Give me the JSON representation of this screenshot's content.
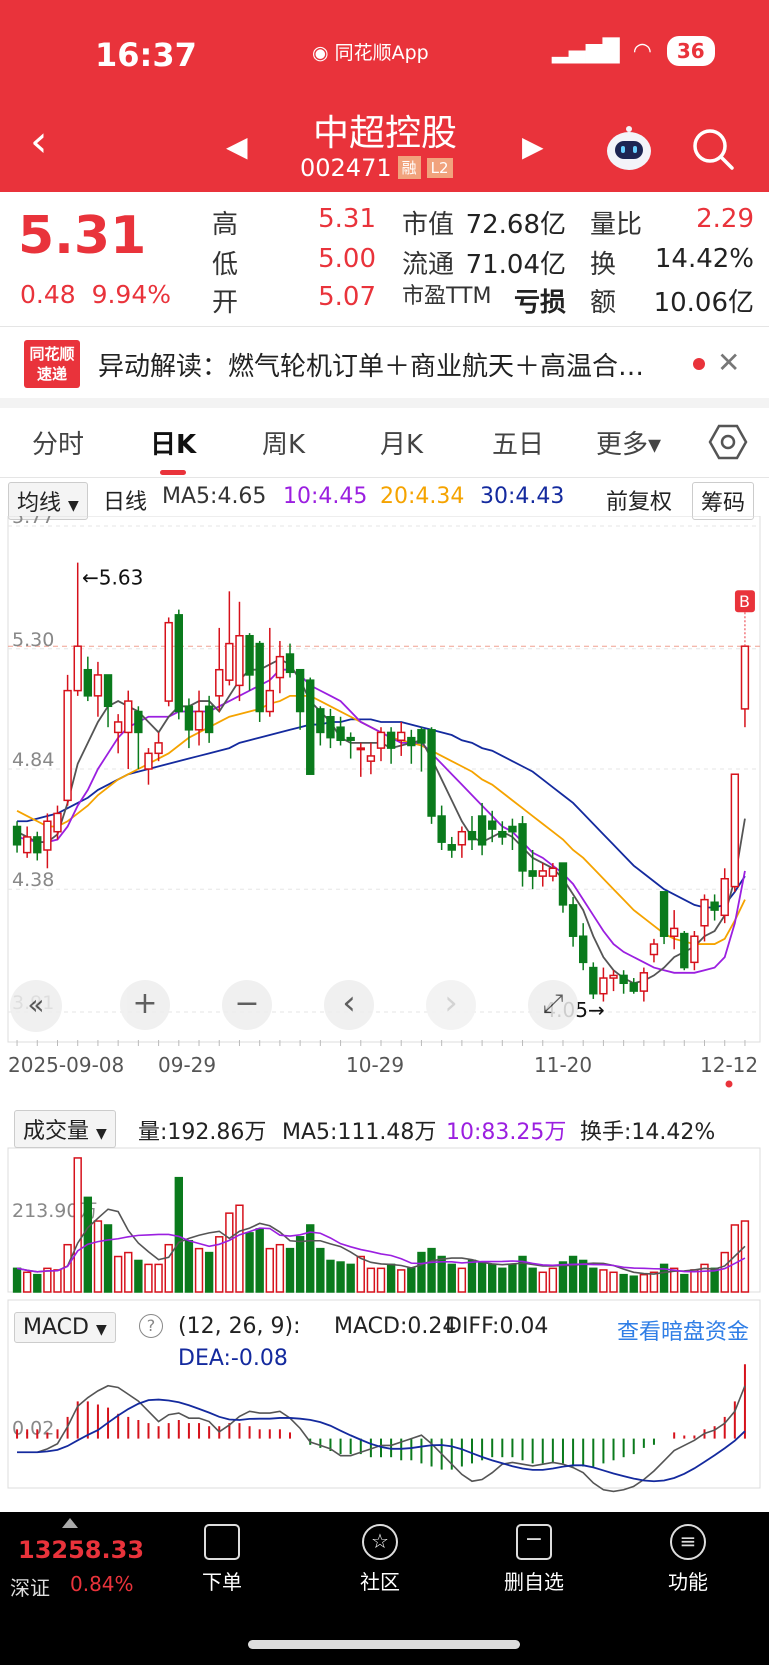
{
  "status": {
    "time": "16:37",
    "app": "同花顺App",
    "battery": "36"
  },
  "header": {
    "name": "中超控股",
    "code": "002471",
    "tag_margin": "融",
    "tag_l2": "L2"
  },
  "quote": {
    "price": "5.31",
    "change": "0.48",
    "change_pct": "9.94%",
    "high_label": "高",
    "high": "5.31",
    "low_label": "低",
    "low": "5.00",
    "open_label": "开",
    "open": "5.07",
    "mktcap_label": "市值",
    "mktcap": "72.68亿",
    "float_label": "流通",
    "float": "71.04亿",
    "pe_label": "市盈TTM",
    "pe": "亏损",
    "vr_label": "量比",
    "vr": "2.29",
    "turnover_label": "换",
    "turnover": "14.42%",
    "amount_label": "额",
    "amount": "10.06亿"
  },
  "news": {
    "logo_top": "同花顺",
    "logo_bottom": "速递",
    "text": "异动解读：燃气轮机订单＋商业航天＋高温合…"
  },
  "tabs": [
    "分时",
    "日K",
    "周K",
    "月K",
    "五日",
    "更多▾"
  ],
  "ma_row": {
    "selector": "均线",
    "period": "日线",
    "ma5": "MA5:4.65",
    "ma10": "10:4.45",
    "ma20": "20:4.34",
    "ma30": "30:4.43",
    "adjust": "前复权",
    "chips": "筹码"
  },
  "kchart": {
    "y_ticks": [
      "5.77",
      "5.30",
      "4.84",
      "4.38",
      "3.91"
    ],
    "high_mark": "←5.63",
    "low_mark": "4.05→",
    "buy_mark": "B",
    "x_ticks": [
      "2025-09-08",
      "09-29",
      "10-29",
      "11-20",
      "12-12"
    ],
    "colors": {
      "up": "#d6111b",
      "down": "#0a7a1c",
      "ma5": "#555555",
      "ma10": "#9b1fe0",
      "ma20": "#f5a300",
      "ma30": "#142a9e"
    }
  },
  "chart_controls": [
    "«",
    "+",
    "−",
    "‹",
    "›",
    "⤢"
  ],
  "volume": {
    "selector": "成交量",
    "vol": "量:192.86万",
    "ma5": "MA5:111.48万",
    "ma10": "10:83.25万",
    "turnover": "换手:14.42%",
    "y_tick": "213.90万"
  },
  "macd": {
    "selector": "MACD",
    "help": "?",
    "params": "(12, 26, 9):",
    "macd": "MACD:0.24",
    "diff": "DIFF:0.04",
    "dea": "DEA:-0.08",
    "link": "查看暗盘资金",
    "y_tick": "0.02"
  },
  "bottom": {
    "index_value": "13258.33",
    "index_name": "深证",
    "index_pct": "0.84%",
    "nav": [
      "下单",
      "社区",
      "删自选",
      "功能"
    ]
  },
  "chart_data": {
    "type": "candlestick",
    "y_range": [
      3.91,
      5.77
    ],
    "candles": [
      [
        4.62,
        4.55,
        4.64,
        4.52
      ],
      [
        4.52,
        4.58,
        4.62,
        4.5
      ],
      [
        4.58,
        4.52,
        4.6,
        4.49
      ],
      [
        4.53,
        4.64,
        4.67,
        4.46
      ],
      [
        4.6,
        4.67,
        4.7,
        4.57
      ],
      [
        4.72,
        5.14,
        5.2,
        4.7
      ],
      [
        5.14,
        5.31,
        5.63,
        5.12
      ],
      [
        5.22,
        5.12,
        5.27,
        5.1
      ],
      [
        5.12,
        5.2,
        5.25,
        5.04
      ],
      [
        5.2,
        5.08,
        5.2,
        5.0
      ],
      [
        4.98,
        5.02,
        5.05,
        4.9
      ],
      [
        4.98,
        5.1,
        5.14,
        4.84
      ],
      [
        5.06,
        4.98,
        5.08,
        4.84
      ],
      [
        4.84,
        4.9,
        4.92,
        4.78
      ],
      [
        4.9,
        4.94,
        4.98,
        4.87
      ],
      [
        5.1,
        5.4,
        5.42,
        5.08
      ],
      [
        5.43,
        5.06,
        5.45,
        5.03
      ],
      [
        5.08,
        4.99,
        5.11,
        4.92
      ],
      [
        4.99,
        5.06,
        5.14,
        4.93
      ],
      [
        5.08,
        4.98,
        5.12,
        4.94
      ],
      [
        5.12,
        5.22,
        5.38,
        5.06
      ],
      [
        5.18,
        5.32,
        5.52,
        5.16
      ],
      [
        5.16,
        5.35,
        5.48,
        5.1
      ],
      [
        5.35,
        5.2,
        5.36,
        5.14
      ],
      [
        5.32,
        5.06,
        5.33,
        5.02
      ],
      [
        5.06,
        5.14,
        5.38,
        5.04
      ],
      [
        5.19,
        5.27,
        5.33,
        5.13
      ],
      [
        5.28,
        5.21,
        5.32,
        5.19
      ],
      [
        5.22,
        5.06,
        5.22,
        4.99
      ],
      [
        5.18,
        4.82,
        5.19,
        4.82
      ],
      [
        5.07,
        4.98,
        5.08,
        4.93
      ],
      [
        5.04,
        4.96,
        5.07,
        4.92
      ],
      [
        5.0,
        4.95,
        5.04,
        4.93
      ],
      [
        4.96,
        4.95,
        4.98,
        4.88
      ],
      [
        4.92,
        4.92,
        4.94,
        4.81
      ],
      [
        4.87,
        4.89,
        4.94,
        4.82
      ],
      [
        4.92,
        4.98,
        5.0,
        4.87
      ],
      [
        4.98,
        4.92,
        5.0,
        4.86
      ],
      [
        4.95,
        4.98,
        5.02,
        4.89
      ],
      [
        4.96,
        4.93,
        4.99,
        4.86
      ],
      [
        4.99,
        4.94,
        5.0,
        4.83
      ],
      [
        4.99,
        4.66,
        5.0,
        4.63
      ],
      [
        4.66,
        4.56,
        4.7,
        4.53
      ],
      [
        4.55,
        4.53,
        4.58,
        4.5
      ],
      [
        4.55,
        4.6,
        4.62,
        4.5
      ],
      [
        4.6,
        4.57,
        4.66,
        4.53
      ],
      [
        4.66,
        4.55,
        4.71,
        4.51
      ],
      [
        4.64,
        4.61,
        4.68,
        4.56
      ],
      [
        4.6,
        4.58,
        4.64,
        4.55
      ],
      [
        4.62,
        4.6,
        4.65,
        4.53
      ],
      [
        4.63,
        4.45,
        4.66,
        4.39
      ],
      [
        4.45,
        4.43,
        4.53,
        4.38
      ],
      [
        4.43,
        4.45,
        4.48,
        4.39
      ],
      [
        4.43,
        4.46,
        4.48,
        4.41
      ],
      [
        4.48,
        4.32,
        4.48,
        4.29
      ],
      [
        4.32,
        4.2,
        4.35,
        4.16
      ],
      [
        4.2,
        4.1,
        4.25,
        4.07
      ],
      [
        4.08,
        3.98,
        4.1,
        3.96
      ],
      [
        3.98,
        4.04,
        4.08,
        3.95
      ],
      [
        4.04,
        4.05,
        4.07,
        3.99
      ],
      [
        4.05,
        4.02,
        4.07,
        3.98
      ],
      [
        4.02,
        3.99,
        4.04,
        3.98
      ],
      [
        3.99,
        4.06,
        4.08,
        3.95
      ],
      [
        4.13,
        4.17,
        4.19,
        4.1
      ],
      [
        4.37,
        4.2,
        4.37,
        4.17
      ],
      [
        4.2,
        4.23,
        4.3,
        4.15
      ],
      [
        4.21,
        4.08,
        4.22,
        4.07
      ],
      [
        4.1,
        4.2,
        4.22,
        4.07
      ],
      [
        4.24,
        4.34,
        4.36,
        4.18
      ],
      [
        4.33,
        4.3,
        4.36,
        4.26
      ],
      [
        4.28,
        4.42,
        4.46,
        4.25
      ],
      [
        4.39,
        4.82,
        4.82,
        4.37
      ],
      [
        5.07,
        5.31,
        5.31,
        5.0
      ]
    ],
    "ma5": [
      4.6,
      4.58,
      4.56,
      4.56,
      4.59,
      4.71,
      4.86,
      4.94,
      5.02,
      5.08,
      5.1,
      5.08,
      5.06,
      5.02,
      4.98,
      5.04,
      5.08,
      5.08,
      5.1,
      5.1,
      5.06,
      5.12,
      5.18,
      5.22,
      5.22,
      5.24,
      5.26,
      5.24,
      5.18,
      5.1,
      5.06,
      5.02,
      4.96,
      4.94,
      4.94,
      4.94,
      4.94,
      4.92,
      4.93,
      4.94,
      4.95,
      4.88,
      4.8,
      4.72,
      4.64,
      4.58,
      4.56,
      4.58,
      4.6,
      4.58,
      4.54,
      4.5,
      4.48,
      4.46,
      4.42,
      4.36,
      4.3,
      4.2,
      4.12,
      4.07,
      4.04,
      4.02,
      4.03,
      4.05,
      4.08,
      4.12,
      4.14,
      4.16,
      4.2,
      4.22,
      4.28,
      4.42,
      4.65
    ],
    "ma10": [
      4.58,
      4.57,
      4.56,
      4.56,
      4.57,
      4.62,
      4.7,
      4.76,
      4.84,
      4.9,
      4.96,
      5.0,
      5.02,
      5.04,
      5.04,
      5.04,
      5.06,
      5.06,
      5.06,
      5.06,
      5.08,
      5.1,
      5.12,
      5.14,
      5.16,
      5.18,
      5.22,
      5.22,
      5.2,
      5.16,
      5.14,
      5.12,
      5.1,
      5.06,
      5.02,
      5.0,
      4.98,
      4.96,
      4.94,
      4.94,
      4.94,
      4.9,
      4.86,
      4.82,
      4.78,
      4.74,
      4.7,
      4.66,
      4.62,
      4.6,
      4.56,
      4.52,
      4.5,
      4.47,
      4.44,
      4.4,
      4.34,
      4.28,
      4.22,
      4.17,
      4.14,
      4.12,
      4.1,
      4.08,
      4.07,
      4.06,
      4.06,
      4.06,
      4.07,
      4.08,
      4.12,
      4.25,
      4.45
    ],
    "ma20": [
      4.68,
      4.66,
      4.64,
      4.62,
      4.62,
      4.64,
      4.67,
      4.7,
      4.74,
      4.77,
      4.8,
      4.82,
      4.84,
      4.86,
      4.88,
      4.9,
      4.93,
      4.96,
      4.98,
      5.0,
      5.02,
      5.04,
      5.05,
      5.06,
      5.07,
      5.09,
      5.1,
      5.12,
      5.12,
      5.12,
      5.1,
      5.08,
      5.06,
      5.04,
      5.02,
      5.0,
      4.98,
      4.96,
      4.95,
      4.94,
      4.93,
      4.91,
      4.89,
      4.87,
      4.85,
      4.83,
      4.8,
      4.78,
      4.75,
      4.72,
      4.69,
      4.66,
      4.63,
      4.6,
      4.57,
      4.53,
      4.5,
      4.46,
      4.42,
      4.38,
      4.34,
      4.3,
      4.27,
      4.24,
      4.21,
      4.19,
      4.18,
      4.17,
      4.17,
      4.17,
      4.19,
      4.26,
      4.34
    ],
    "ma30": [
      4.64,
      4.64,
      4.65,
      4.66,
      4.67,
      4.69,
      4.71,
      4.73,
      4.76,
      4.78,
      4.8,
      4.82,
      4.83,
      4.84,
      4.85,
      4.86,
      4.87,
      4.88,
      4.89,
      4.9,
      4.91,
      4.92,
      4.94,
      4.95,
      4.96,
      4.97,
      4.98,
      4.99,
      5.0,
      5.01,
      5.01,
      5.02,
      5.02,
      5.03,
      5.03,
      5.03,
      5.02,
      5.02,
      5.02,
      5.01,
      5.0,
      4.99,
      4.98,
      4.97,
      4.95,
      4.94,
      4.92,
      4.91,
      4.89,
      4.87,
      4.85,
      4.83,
      4.8,
      4.77,
      4.74,
      4.71,
      4.67,
      4.63,
      4.59,
      4.55,
      4.51,
      4.47,
      4.44,
      4.41,
      4.38,
      4.36,
      4.34,
      4.32,
      4.31,
      4.31,
      4.32,
      4.37,
      4.43
    ],
    "volume": [
      0.3,
      0.25,
      0.22,
      0.3,
      0.28,
      0.6,
      1.7,
      1.2,
      0.9,
      0.85,
      0.45,
      0.5,
      0.4,
      0.35,
      0.35,
      0.6,
      1.45,
      0.65,
      0.55,
      0.5,
      0.7,
      1.0,
      1.1,
      0.75,
      0.8,
      0.55,
      0.6,
      0.55,
      0.7,
      0.85,
      0.55,
      0.4,
      0.38,
      0.35,
      0.45,
      0.3,
      0.3,
      0.35,
      0.28,
      0.3,
      0.5,
      0.55,
      0.45,
      0.35,
      0.3,
      0.4,
      0.38,
      0.35,
      0.3,
      0.35,
      0.45,
      0.3,
      0.25,
      0.3,
      0.38,
      0.45,
      0.4,
      0.3,
      0.28,
      0.25,
      0.22,
      0.2,
      0.22,
      0.25,
      0.35,
      0.3,
      0.22,
      0.28,
      0.35,
      0.3,
      0.5,
      0.85,
      0.9
    ],
    "macd": [
      0.03,
      0.03,
      0.03,
      0.02,
      0.03,
      0.07,
      0.12,
      0.12,
      0.11,
      0.1,
      0.08,
      0.07,
      0.06,
      0.05,
      0.04,
      0.05,
      0.06,
      0.05,
      0.05,
      0.04,
      0.04,
      0.05,
      0.05,
      0.04,
      0.03,
      0.03,
      0.03,
      0.02,
      0.0,
      -0.02,
      -0.03,
      -0.04,
      -0.05,
      -0.05,
      -0.05,
      -0.06,
      -0.06,
      -0.06,
      -0.07,
      -0.07,
      -0.08,
      -0.09,
      -0.1,
      -0.1,
      -0.09,
      -0.08,
      -0.07,
      -0.06,
      -0.06,
      -0.06,
      -0.07,
      -0.08,
      -0.08,
      -0.08,
      -0.08,
      -0.09,
      -0.09,
      -0.09,
      -0.08,
      -0.07,
      -0.06,
      -0.05,
      -0.03,
      -0.02,
      0.0,
      0.02,
      0.01,
      0.01,
      0.03,
      0.04,
      0.07,
      0.12,
      0.24
    ]
  }
}
